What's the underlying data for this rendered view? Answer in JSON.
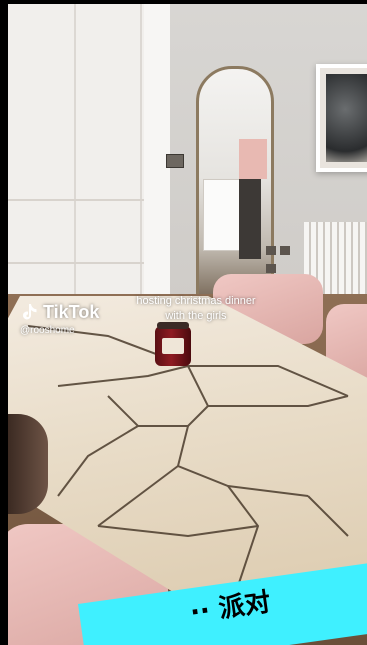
{
  "video": {
    "caption_line1": "hosting christmas dinner",
    "caption_line2": "with the girls",
    "brand": "TikTok",
    "handle": "@rooshome"
  },
  "banner": {
    "text": "·· 派对"
  },
  "colors": {
    "banner_bg": "#3ff0ff",
    "candle": "#8e1b22",
    "chair": "#e6b6b0"
  }
}
